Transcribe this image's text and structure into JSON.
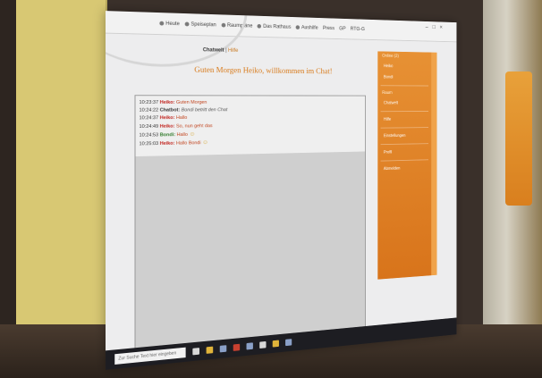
{
  "browser": {
    "bookmarks": [
      "Heute",
      "Speiseplan",
      "Raumpläne",
      "Das Rathaus",
      "Aushilfe",
      "Press",
      "GP",
      "RTG-G"
    ]
  },
  "site": {
    "nav": {
      "home": "Chatwelt",
      "sep": "|",
      "logout": "Hilfe"
    },
    "welcome": "Guten Morgen Heiko, willkommen im Chat!"
  },
  "chat": {
    "messages": [
      {
        "time": "10:23:37",
        "user": "Heiko:",
        "text": "Guten Morgen",
        "type": "heiko"
      },
      {
        "time": "10:24:22",
        "user": "Chatbot:",
        "text": "Bondi betritt den Chat",
        "type": "chatbot"
      },
      {
        "time": "10:24:37",
        "user": "Heiko:",
        "text": "Hallo",
        "type": "heiko"
      },
      {
        "time": "10:24:49",
        "user": "Heiko:",
        "text": "So, nun geht das",
        "type": "heiko"
      },
      {
        "time": "10:24:53",
        "user": "Bondi:",
        "text": "Hallo",
        "type": "bondi",
        "smiley": true
      },
      {
        "time": "10:25:03",
        "user": "Heiko:",
        "text": "Hallo Bondi",
        "type": "heiko",
        "smiley": true
      }
    ]
  },
  "sidebar": {
    "online_title": "Online (2)",
    "online_users": [
      "Heiko",
      "Bondi"
    ],
    "room_title": "Raum",
    "room_users": [
      "Chatwelt"
    ],
    "items": [
      "Hilfe",
      "Einstellungen",
      "Profil",
      "Abmelden"
    ]
  },
  "taskbar": {
    "search_placeholder": "Zur Suche Text hier eingeben"
  },
  "colors": {
    "accent_orange": "#d87a1a",
    "sidebar_orange": "#e08527",
    "user_heiko": "#c0201a",
    "user_bondi": "#2f7a2a"
  }
}
